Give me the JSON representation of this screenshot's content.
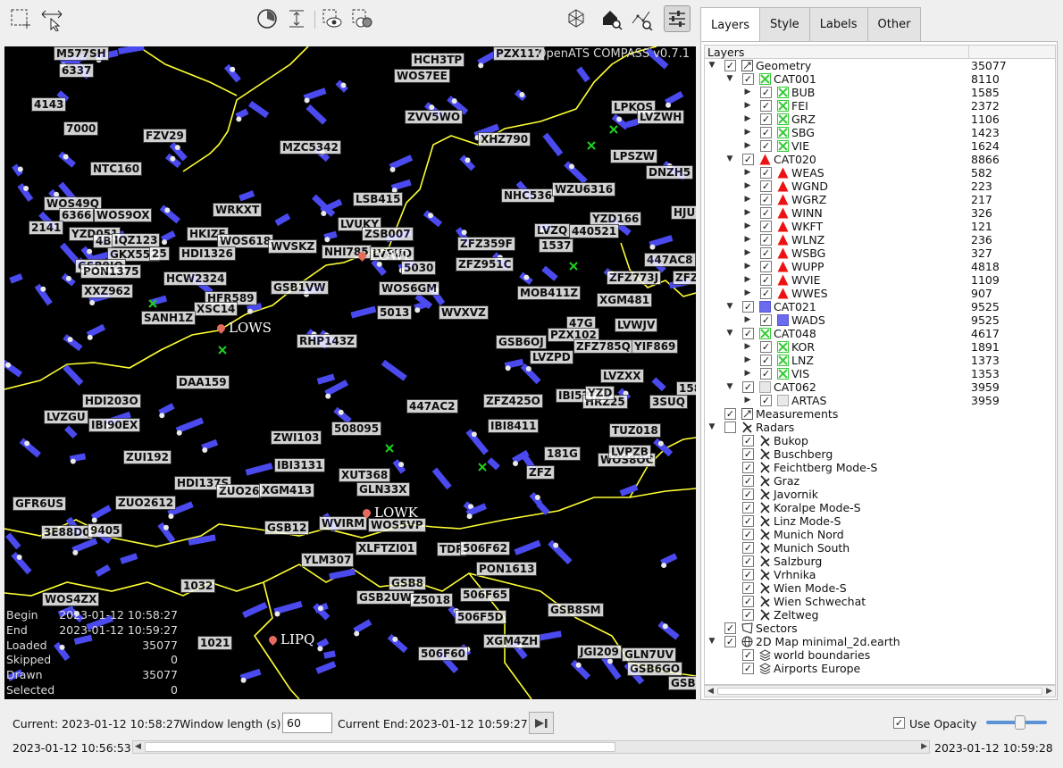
{
  "app": {
    "watermark": "OpenATS COMPASS v0.7.1"
  },
  "toolbar": {
    "icons": [
      "select-rectangle-icon",
      "zoom-arrows-icon",
      "clock-icon",
      "height-icon",
      "eye-select-icon",
      "filter-select-icon",
      "position-icon",
      "home-search-icon",
      "route-search-icon",
      "settings-sliders-icon"
    ]
  },
  "tabs": [
    "Layers",
    "Style",
    "Labels",
    "Other"
  ],
  "tree": {
    "header": "Layers",
    "rows": [
      {
        "level": 0,
        "exp": "down",
        "chk": true,
        "icon": "measure",
        "name": "Geometry",
        "count": "35077"
      },
      {
        "level": 1,
        "exp": "down",
        "chk": true,
        "icon": "xgreen",
        "name": "CAT001",
        "count": "8110"
      },
      {
        "level": 2,
        "exp": "right",
        "chk": true,
        "icon": "xgreen",
        "name": "BUB",
        "count": "1585"
      },
      {
        "level": 2,
        "exp": "right",
        "chk": true,
        "icon": "xgreen",
        "name": "FEI",
        "count": "2372"
      },
      {
        "level": 2,
        "exp": "right",
        "chk": true,
        "icon": "xgreen",
        "name": "GRZ",
        "count": "1106"
      },
      {
        "level": 2,
        "exp": "right",
        "chk": true,
        "icon": "xgreen",
        "name": "SBG",
        "count": "1423"
      },
      {
        "level": 2,
        "exp": "right",
        "chk": true,
        "icon": "xgreen",
        "name": "VIE",
        "count": "1624"
      },
      {
        "level": 1,
        "exp": "down",
        "chk": true,
        "icon": "tri",
        "name": "CAT020",
        "count": "8866"
      },
      {
        "level": 2,
        "exp": "right",
        "chk": true,
        "icon": "tri",
        "name": "WEAS",
        "count": "582"
      },
      {
        "level": 2,
        "exp": "right",
        "chk": true,
        "icon": "tri",
        "name": "WGND",
        "count": "223"
      },
      {
        "level": 2,
        "exp": "right",
        "chk": true,
        "icon": "tri",
        "name": "WGRZ",
        "count": "217"
      },
      {
        "level": 2,
        "exp": "right",
        "chk": true,
        "icon": "tri",
        "name": "WINN",
        "count": "326"
      },
      {
        "level": 2,
        "exp": "right",
        "chk": true,
        "icon": "tri",
        "name": "WKFT",
        "count": "121"
      },
      {
        "level": 2,
        "exp": "right",
        "chk": true,
        "icon": "tri",
        "name": "WLNZ",
        "count": "236"
      },
      {
        "level": 2,
        "exp": "right",
        "chk": true,
        "icon": "tri",
        "name": "WSBG",
        "count": "327"
      },
      {
        "level": 2,
        "exp": "right",
        "chk": true,
        "icon": "tri",
        "name": "WUPP",
        "count": "4818"
      },
      {
        "level": 2,
        "exp": "right",
        "chk": true,
        "icon": "tri",
        "name": "WVIE",
        "count": "1109"
      },
      {
        "level": 2,
        "exp": "right",
        "chk": true,
        "icon": "tri",
        "name": "WWES",
        "count": "907"
      },
      {
        "level": 1,
        "exp": "down",
        "chk": true,
        "icon": "bluesq",
        "name": "CAT021",
        "count": "9525"
      },
      {
        "level": 2,
        "exp": "right",
        "chk": true,
        "icon": "bluesq",
        "name": "WADS",
        "count": "9525"
      },
      {
        "level": 1,
        "exp": "down",
        "chk": true,
        "icon": "xgreen",
        "name": "CAT048",
        "count": "4617"
      },
      {
        "level": 2,
        "exp": "right",
        "chk": true,
        "icon": "xgreen",
        "name": "KOR",
        "count": "1891"
      },
      {
        "level": 2,
        "exp": "right",
        "chk": true,
        "icon": "xgreen",
        "name": "LNZ",
        "count": "1373"
      },
      {
        "level": 2,
        "exp": "right",
        "chk": true,
        "icon": "xgreen",
        "name": "VIS",
        "count": "1353"
      },
      {
        "level": 1,
        "exp": "down",
        "chk": true,
        "icon": "greysq",
        "name": "CAT062",
        "count": "3959"
      },
      {
        "level": 2,
        "exp": "right",
        "chk": true,
        "icon": "greysq",
        "name": "ARTAS",
        "count": "3959"
      },
      {
        "level": 0,
        "exp": "",
        "chk": true,
        "icon": "measure",
        "name": "Measurements",
        "count": ""
      },
      {
        "level": 0,
        "exp": "down",
        "chk": false,
        "icon": "radar",
        "name": "Radars",
        "count": ""
      },
      {
        "level": 1,
        "exp": "",
        "chk": true,
        "icon": "radar",
        "name": "Bukop",
        "count": ""
      },
      {
        "level": 1,
        "exp": "",
        "chk": true,
        "icon": "radar",
        "name": "Buschberg",
        "count": ""
      },
      {
        "level": 1,
        "exp": "",
        "chk": true,
        "icon": "radar",
        "name": "Feichtberg Mode-S",
        "count": ""
      },
      {
        "level": 1,
        "exp": "",
        "chk": true,
        "icon": "radar",
        "name": "Graz",
        "count": ""
      },
      {
        "level": 1,
        "exp": "",
        "chk": true,
        "icon": "radar",
        "name": "Javornik",
        "count": ""
      },
      {
        "level": 1,
        "exp": "",
        "chk": true,
        "icon": "radar",
        "name": "Koralpe Mode-S",
        "count": ""
      },
      {
        "level": 1,
        "exp": "",
        "chk": true,
        "icon": "radar",
        "name": "Linz Mode-S",
        "count": ""
      },
      {
        "level": 1,
        "exp": "",
        "chk": true,
        "icon": "radar",
        "name": "Munich Nord",
        "count": ""
      },
      {
        "level": 1,
        "exp": "",
        "chk": true,
        "icon": "radar",
        "name": "Munich South",
        "count": ""
      },
      {
        "level": 1,
        "exp": "",
        "chk": true,
        "icon": "radar",
        "name": "Salzburg",
        "count": ""
      },
      {
        "level": 1,
        "exp": "",
        "chk": true,
        "icon": "radar",
        "name": "Vrhnika",
        "count": ""
      },
      {
        "level": 1,
        "exp": "",
        "chk": true,
        "icon": "radar",
        "name": "Wien Mode-S",
        "count": ""
      },
      {
        "level": 1,
        "exp": "",
        "chk": true,
        "icon": "radar",
        "name": "Wien Schwechat",
        "count": ""
      },
      {
        "level": 1,
        "exp": "",
        "chk": true,
        "icon": "radar",
        "name": "Zeltweg",
        "count": ""
      },
      {
        "level": 0,
        "exp": "",
        "chk": true,
        "icon": "sector",
        "name": "Sectors",
        "count": ""
      },
      {
        "level": 0,
        "exp": "down",
        "chk": true,
        "icon": "globe",
        "name": "2D Map minimal_2d.earth",
        "count": ""
      },
      {
        "level": 1,
        "exp": "",
        "chk": true,
        "icon": "stack",
        "name": "world boundaries",
        "count": ""
      },
      {
        "level": 1,
        "exp": "",
        "chk": true,
        "icon": "stack",
        "name": "Airports Europe",
        "count": ""
      }
    ]
  },
  "stats": [
    {
      "k": "Begin",
      "v": "2023-01-12 10:58:27"
    },
    {
      "k": "End",
      "v": "2023-01-12 10:59:27"
    },
    {
      "k": "Loaded",
      "v": "35077"
    },
    {
      "k": "Skipped",
      "v": "0"
    },
    {
      "k": "Drawn",
      "v": "35077"
    },
    {
      "k": "Selected",
      "v": "0"
    }
  ],
  "map": {
    "labels": [
      "M577SH",
      "6337",
      "4143",
      "7000",
      "FZV29",
      "NTC160",
      "WOS49Q",
      "6366",
      "2141",
      "WOS9OX",
      "YZD051",
      "4B",
      "IQZ123",
      "GKX552",
      "25",
      "GSB9IQ",
      "PON1375",
      "XXZ962",
      "HKIZE",
      "WRKXT",
      "WOS618",
      "HDI1326",
      "HCW2324",
      "HFR589",
      "XSC14",
      "SANH1Z",
      "MZC5342",
      "WVSKZ",
      "LSB415",
      "LVUKY",
      "ZSB007",
      "NHI785",
      "LVPUO",
      "5030",
      "GSB1VW",
      "WOS6GM",
      "5013",
      "RHP143Z",
      "DAA159",
      "HDI203O",
      "LVZGU",
      "IBI90EX",
      "ZWI103",
      "508095",
      "ZUI192",
      "IBI3131",
      "HDI137S",
      "ZUO26",
      "XGM413",
      "XUT368",
      "GLN33X",
      "ZUO2612",
      "GSB12",
      "WVIRM",
      "WOS5VP",
      "XLFTZI01",
      "YLM307",
      "GFR6US",
      "3E88D0",
      "9405",
      "WOS4ZX",
      "1032",
      "1021",
      "GSB8",
      "GSB2UW",
      "Z5018",
      "TDR",
      "506F62",
      "PON1613",
      "506F65",
      "506F5D",
      "GSB8SM",
      "XGM4ZH",
      "506F60",
      "JGI209",
      "GLN7UV",
      "GSB6GO",
      "GSB",
      "HCH3TP",
      "PZX117",
      "WOS7EE",
      "ZVV5WO",
      "XHZ790",
      "LPKOS",
      "LVZWH",
      "NHC536",
      "WZU6316",
      "LPSZW",
      "DNZH5",
      "YZD166",
      "440521",
      "1537",
      "LVZQ",
      "HJU",
      "ZFZ359F",
      "ZFZ951C",
      "447AC8",
      "ZFZ33",
      "ZFZ773J",
      "XGM481",
      "MOB411Z",
      "WVXVZ",
      "47G",
      "LVWJV",
      "PZX102",
      "GSB6OJ",
      "ZFZ785Q",
      "YIF869",
      "LVZPD",
      "LVZXX",
      "IBI52TA",
      "HRZ25",
      "3SUQ",
      "ZFZ425O",
      "447AC2",
      "IBI8411",
      "TUZ018",
      "181G",
      "WOS8OC",
      "LVPZB",
      "ZFZ",
      "1589",
      "YZD"
    ],
    "airports": [
      "LOWS",
      "LOWL",
      "LOWK",
      "LIPQ"
    ]
  },
  "bottom": {
    "current_label": "Current:",
    "current_value": "2023-01-12 10:58:27",
    "window_label": "Window length (s)",
    "window_value": "60",
    "current_end_label": "Current End:",
    "current_end_value": "2023-01-12 10:59:27",
    "use_opacity": "Use Opacity",
    "opacity_level": 0.56,
    "range_start": "2023-01-12 10:56:53",
    "range_end": "2023-01-12 10:59:28"
  },
  "colors": {
    "map_bg": "#000000",
    "boundary": "#ffff00",
    "track_blue": "#4a4aee",
    "airport_pin": "#e56b5d",
    "accent": "#5c93d6"
  }
}
